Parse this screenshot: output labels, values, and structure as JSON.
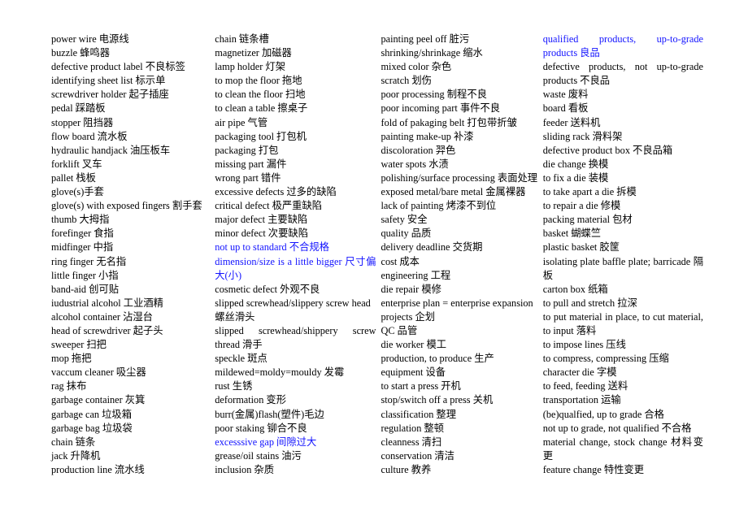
{
  "document": {
    "title": "English-Chinese Factory / Quality Terms Glossary",
    "layout": "four-column-list",
    "colors": {
      "text": "#000000",
      "highlight_blue": "#1414ff",
      "background": "#ffffff"
    }
  },
  "columns": [
    {
      "id": "column-1",
      "entries": [
        {
          "text": "power wire 电源线",
          "color": "black",
          "justify": false
        },
        {
          "text": "buzzle 蜂鸣器",
          "color": "black",
          "justify": false
        },
        {
          "text": "defective product label 不良标签",
          "color": "black",
          "justify": false
        },
        {
          "text": "identifying sheet list 标示单",
          "color": "black",
          "justify": false
        },
        {
          "text": "screwdriver holder 起子插座",
          "color": "black",
          "justify": false
        },
        {
          "text": "pedal 踩踏板",
          "color": "black",
          "justify": false
        },
        {
          "text": "stopper 阻挡器",
          "color": "black",
          "justify": false
        },
        {
          "text": "flow board 流水板",
          "color": "black",
          "justify": false
        },
        {
          "text": "hydraulic handjack 油压板车",
          "color": "black",
          "justify": false
        },
        {
          "text": "forklift 叉车",
          "color": "black",
          "justify": false
        },
        {
          "text": "pallet 栈板",
          "color": "black",
          "justify": false
        },
        {
          "text": "glove(s)手套",
          "color": "black",
          "justify": false
        },
        {
          "text": "glove(s) with exposed fingers 割手套",
          "color": "black",
          "justify": false
        },
        {
          "text": "thumb 大拇指",
          "color": "black",
          "justify": false
        },
        {
          "text": "forefinger 食指",
          "color": "black",
          "justify": false
        },
        {
          "text": "midfinger 中指",
          "color": "black",
          "justify": false
        },
        {
          "text": "ring finger 无名指",
          "color": "black",
          "justify": false
        },
        {
          "text": "little finger 小指",
          "color": "black",
          "justify": false
        },
        {
          "text": "band-aid 创可贴",
          "color": "black",
          "justify": false
        },
        {
          "text": "iudustrial alcohol 工业酒精",
          "color": "black",
          "justify": false
        },
        {
          "text": "alcohol container 沾湿台",
          "color": "black",
          "justify": false
        },
        {
          "text": "head of screwdriver 起子头",
          "color": "black",
          "justify": false
        },
        {
          "text": "sweeper 扫把",
          "color": "black",
          "justify": false
        },
        {
          "text": "mop 拖把",
          "color": "black",
          "justify": false
        },
        {
          "text": "vaccum cleaner 吸尘器",
          "color": "black",
          "justify": false
        },
        {
          "text": "rag  抹布",
          "color": "black",
          "justify": false
        },
        {
          "text": "garbage container 灰箕",
          "color": "black",
          "justify": false
        },
        {
          "text": "garbage can 垃圾箱",
          "color": "black",
          "justify": false
        },
        {
          "text": "garbage bag 垃圾袋",
          "color": "black",
          "justify": false
        },
        {
          "text": "chain 链条",
          "color": "black",
          "justify": false
        },
        {
          "text": "jack 升降机",
          "color": "black",
          "justify": false
        },
        {
          "text": "production line 流水线",
          "color": "black",
          "justify": false
        }
      ]
    },
    {
      "id": "column-2",
      "entries": [
        {
          "text": "chain 链条槽",
          "color": "black",
          "justify": false
        },
        {
          "text": "magnetizer 加磁器",
          "color": "black",
          "justify": false
        },
        {
          "text": "lamp holder 灯架",
          "color": "black",
          "justify": false
        },
        {
          "text": "to mop the floor 拖地",
          "color": "black",
          "justify": false
        },
        {
          "text": "to clean the floor 扫地",
          "color": "black",
          "justify": false
        },
        {
          "text": "to clean a table 擦桌子",
          "color": "black",
          "justify": false
        },
        {
          "text": "air pipe  气管",
          "color": "black",
          "justify": false
        },
        {
          "text": "packaging tool 打包机",
          "color": "black",
          "justify": false
        },
        {
          "text": "packaging 打包",
          "color": "black",
          "justify": false
        },
        {
          "text": "missing part 漏件",
          "color": "black",
          "justify": false
        },
        {
          "text": "wrong part 错件",
          "color": "black",
          "justify": false
        },
        {
          "text": "excessive defects 过多的缺陷",
          "color": "black",
          "justify": false
        },
        {
          "text": "critical defect 极严重缺陷",
          "color": "black",
          "justify": false
        },
        {
          "text": "major defect 主要缺陷",
          "color": "black",
          "justify": false
        },
        {
          "text": "minor defect 次要缺陷",
          "color": "black",
          "justify": false
        },
        {
          "text": "not up to standard 不合规格",
          "color": "blue",
          "justify": false
        },
        {
          "text": "dimension/size is a little bigger 尺寸偏大(小)",
          "color": "blue",
          "justify": true
        },
        {
          "text": "cosmetic defect 外观不良",
          "color": "black",
          "justify": false
        },
        {
          "text": "slipped screwhead/slippery screw head 螺丝滑头",
          "color": "black",
          "justify": false
        },
        {
          "text": "slipped    screwhead/shippery    screw thread 滑手",
          "color": "black",
          "justify": true
        },
        {
          "text": "speckle 斑点",
          "color": "black",
          "justify": false
        },
        {
          "text": "mildewed=moldy=mouldy 发霉",
          "color": "black",
          "justify": false
        },
        {
          "text": "rust 生锈",
          "color": "black",
          "justify": false
        },
        {
          "text": "deformation 变形",
          "color": "black",
          "justify": false
        },
        {
          "text": "burr(金属)flash(塑件)毛边",
          "color": "black",
          "justify": false
        },
        {
          "text": "poor staking 铆合不良",
          "color": "black",
          "justify": false
        },
        {
          "text": "excesssive gap 间隙过大",
          "color": "blue",
          "justify": false
        },
        {
          "text": "grease/oil stains 油污",
          "color": "black",
          "justify": false
        },
        {
          "text": "inclusion 杂质",
          "color": "black",
          "justify": false
        }
      ]
    },
    {
      "id": "column-3",
      "entries": [
        {
          "text": "painting peel off 脏污",
          "color": "black",
          "justify": false
        },
        {
          "text": "shrinking/shrinkage 缩水",
          "color": "black",
          "justify": false
        },
        {
          "text": "mixed color 杂色",
          "color": "black",
          "justify": false
        },
        {
          "text": "scratch 划伤",
          "color": "black",
          "justify": false
        },
        {
          "text": "poor processing  制程不良",
          "color": "black",
          "justify": false
        },
        {
          "text": "poor incoming part 事件不良",
          "color": "black",
          "justify": false
        },
        {
          "text": "fold of pakaging belt 打包带折皱",
          "color": "black",
          "justify": false
        },
        {
          "text": "painting make-up 补漆",
          "color": "black",
          "justify": false
        },
        {
          "text": "discoloration 羿色",
          "color": "black",
          "justify": false
        },
        {
          "text": "water spots 水渍",
          "color": "black",
          "justify": false
        },
        {
          "text": "polishing/surface processing 表面处理",
          "color": "black",
          "justify": false
        },
        {
          "text": "exposed metal/bare metal 金属裸器",
          "color": "black",
          "justify": false
        },
        {
          "text": "lack of painting 烤漆不到位",
          "color": "black",
          "justify": false
        },
        {
          "text": "safety 安全",
          "color": "black",
          "justify": false
        },
        {
          "text": "quality 品质",
          "color": "black",
          "justify": false
        },
        {
          "text": "delivery deadline 交货期",
          "color": "black",
          "justify": false
        },
        {
          "text": "cost 成本",
          "color": "black",
          "justify": false
        },
        {
          "text": "engineering 工程",
          "color": "black",
          "justify": false
        },
        {
          "text": "die repair 模修",
          "color": "black",
          "justify": false
        },
        {
          "text": "enterprise plan = enterprise expansion",
          "color": "black",
          "justify": true
        },
        {
          "text": "projects 企划",
          "color": "black",
          "justify": false
        },
        {
          "text": "QC 品管",
          "color": "black",
          "justify": false
        },
        {
          "text": "die worker 模工",
          "color": "black",
          "justify": false
        },
        {
          "text": "production, to produce 生产",
          "color": "black",
          "justify": false
        },
        {
          "text": "equipment 设备",
          "color": "black",
          "justify": false
        },
        {
          "text": "to start a press 开机",
          "color": "black",
          "justify": false
        },
        {
          "text": "stop/switch off a press 关机",
          "color": "black",
          "justify": false
        },
        {
          "text": "classification 整理",
          "color": "black",
          "justify": false
        },
        {
          "text": "regulation 整顿",
          "color": "black",
          "justify": false
        },
        {
          "text": "cleanness 清扫",
          "color": "black",
          "justify": false
        },
        {
          "text": "conservation 清洁",
          "color": "black",
          "justify": false
        },
        {
          "text": "culture 教养",
          "color": "black",
          "justify": false
        }
      ]
    },
    {
      "id": "column-4",
      "entries": [
        {
          "text": "qualified products, up-to-grade products 良品",
          "color": "blue",
          "justify": true
        },
        {
          "text": "defective products, not up-to-grade products 不良品",
          "color": "black",
          "justify": true
        },
        {
          "text": "waste 废料",
          "color": "black",
          "justify": false
        },
        {
          "text": "board 看板",
          "color": "black",
          "justify": false
        },
        {
          "text": "feeder 送料机",
          "color": "black",
          "justify": false
        },
        {
          "text": "sliding rack 滑料架",
          "color": "black",
          "justify": false
        },
        {
          "text": "defective product box 不良品箱",
          "color": "black",
          "justify": false
        },
        {
          "text": "die change  换模",
          "color": "black",
          "justify": false
        },
        {
          "text": "to fix a die 装模",
          "color": "black",
          "justify": false
        },
        {
          "text": "to take apart a die 拆模",
          "color": "black",
          "justify": false
        },
        {
          "text": "to repair a die 修模",
          "color": "black",
          "justify": false
        },
        {
          "text": "packing material 包材",
          "color": "black",
          "justify": false
        },
        {
          "text": "basket 蝴蝶竺",
          "color": "black",
          "justify": false
        },
        {
          "text": "plastic basket 胶筐",
          "color": "black",
          "justify": false
        },
        {
          "text": "isolating plate baffle plate; barricade 隔板",
          "color": "black",
          "justify": true
        },
        {
          "text": "carton box 纸箱",
          "color": "black",
          "justify": false
        },
        {
          "text": "to pull and stretch 拉深",
          "color": "black",
          "justify": false
        },
        {
          "text": "to put material in place, to cut material, to input 落料",
          "color": "black",
          "justify": true
        },
        {
          "text": "to impose lines 压线",
          "color": "black",
          "justify": false
        },
        {
          "text": "to compress, compressing 压缩",
          "color": "black",
          "justify": false
        },
        {
          "text": "character die 字模",
          "color": "black",
          "justify": false
        },
        {
          "text": "to feed, feeding 送料",
          "color": "black",
          "justify": false
        },
        {
          "text": "transportation 运输",
          "color": "black",
          "justify": false
        },
        {
          "text": "(be)qualfied, up to grade 合格",
          "color": "black",
          "justify": false
        },
        {
          "text": "not up to grade, not qualified 不合格",
          "color": "black",
          "justify": false
        },
        {
          "text": "material change, stock change 材料变更",
          "color": "black",
          "justify": true
        },
        {
          "text": "feature change  特性变更",
          "color": "black",
          "justify": false
        }
      ]
    }
  ]
}
